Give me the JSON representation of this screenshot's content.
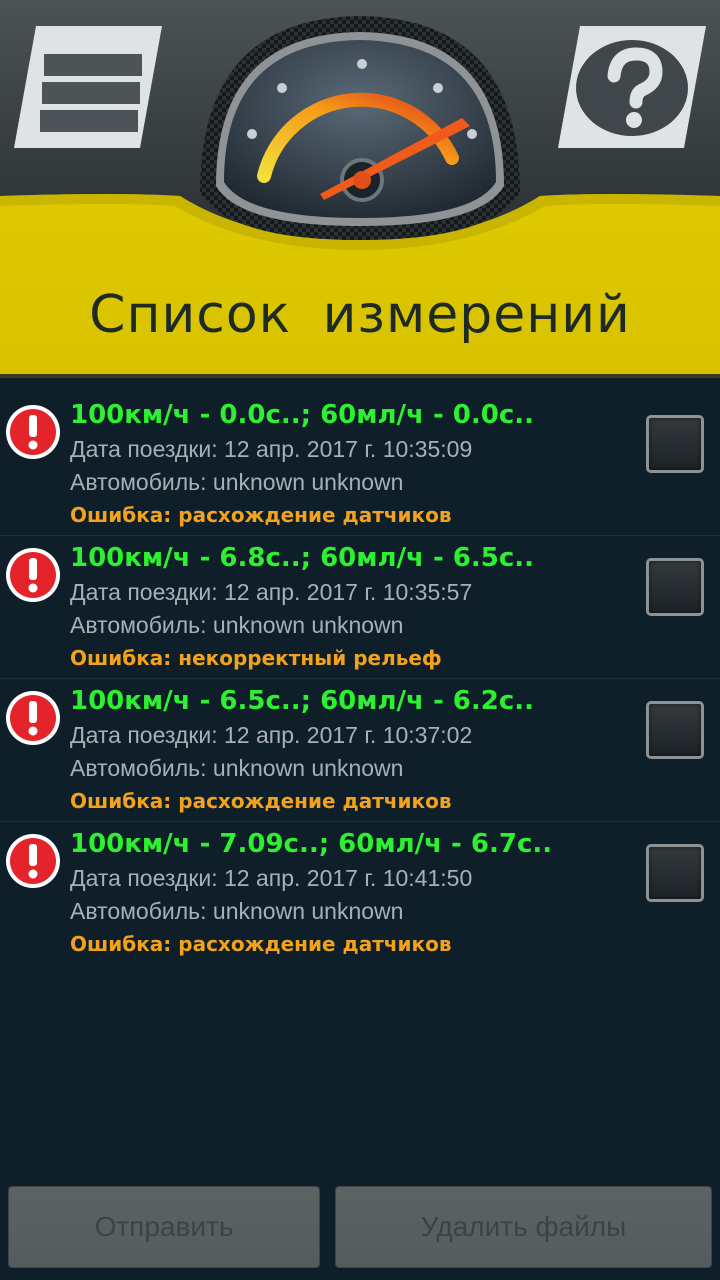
{
  "header": {
    "title": "Список измерений",
    "menu_icon": "list-menu-icon",
    "help_icon": "help-question-icon",
    "logo_icon": "speedometer-gauge-icon",
    "colors": {
      "yellow": "#ddc600",
      "dark_top": "#3b4245",
      "title_text": "#1e2a24"
    }
  },
  "measurements": [
    {
      "title": "100км/ч - 0.0с..; 60мл/ч - 0.0с..",
      "date": "Дата поездки: 12 апр. 2017 г. 10:35:09",
      "car": "Автомобиль: unknown unknown",
      "error": "Ошибка: расхождение датчиков",
      "checked": false
    },
    {
      "title": "100км/ч - 6.8с..; 60мл/ч - 6.5с..",
      "date": "Дата поездки: 12 апр. 2017 г. 10:35:57",
      "car": "Автомобиль: unknown unknown",
      "error": "Ошибка: некорректный рельеф",
      "checked": false
    },
    {
      "title": "100км/ч - 6.5с..; 60мл/ч - 6.2с..",
      "date": "Дата поездки: 12 апр. 2017 г. 10:37:02",
      "car": "Автомобиль: unknown unknown",
      "error": "Ошибка: расхождение датчиков",
      "checked": false
    },
    {
      "title": "100км/ч - 7.09с..; 60мл/ч - 6.7с..",
      "date": "Дата поездки: 12 апр. 2017 г. 10:41:50",
      "car": "Автомобиль: unknown unknown",
      "error": "Ошибка: расхождение датчиков",
      "checked": false
    }
  ],
  "row_icon": "error-exclamation-icon",
  "colors": {
    "title_green": "#2df031",
    "info_gray": "#a8b0b6",
    "error_orange": "#f2a21c",
    "background": "#0f1f29"
  },
  "buttons": {
    "send_label": "Отправить",
    "delete_label": "Удалить файлы",
    "enabled": false
  }
}
